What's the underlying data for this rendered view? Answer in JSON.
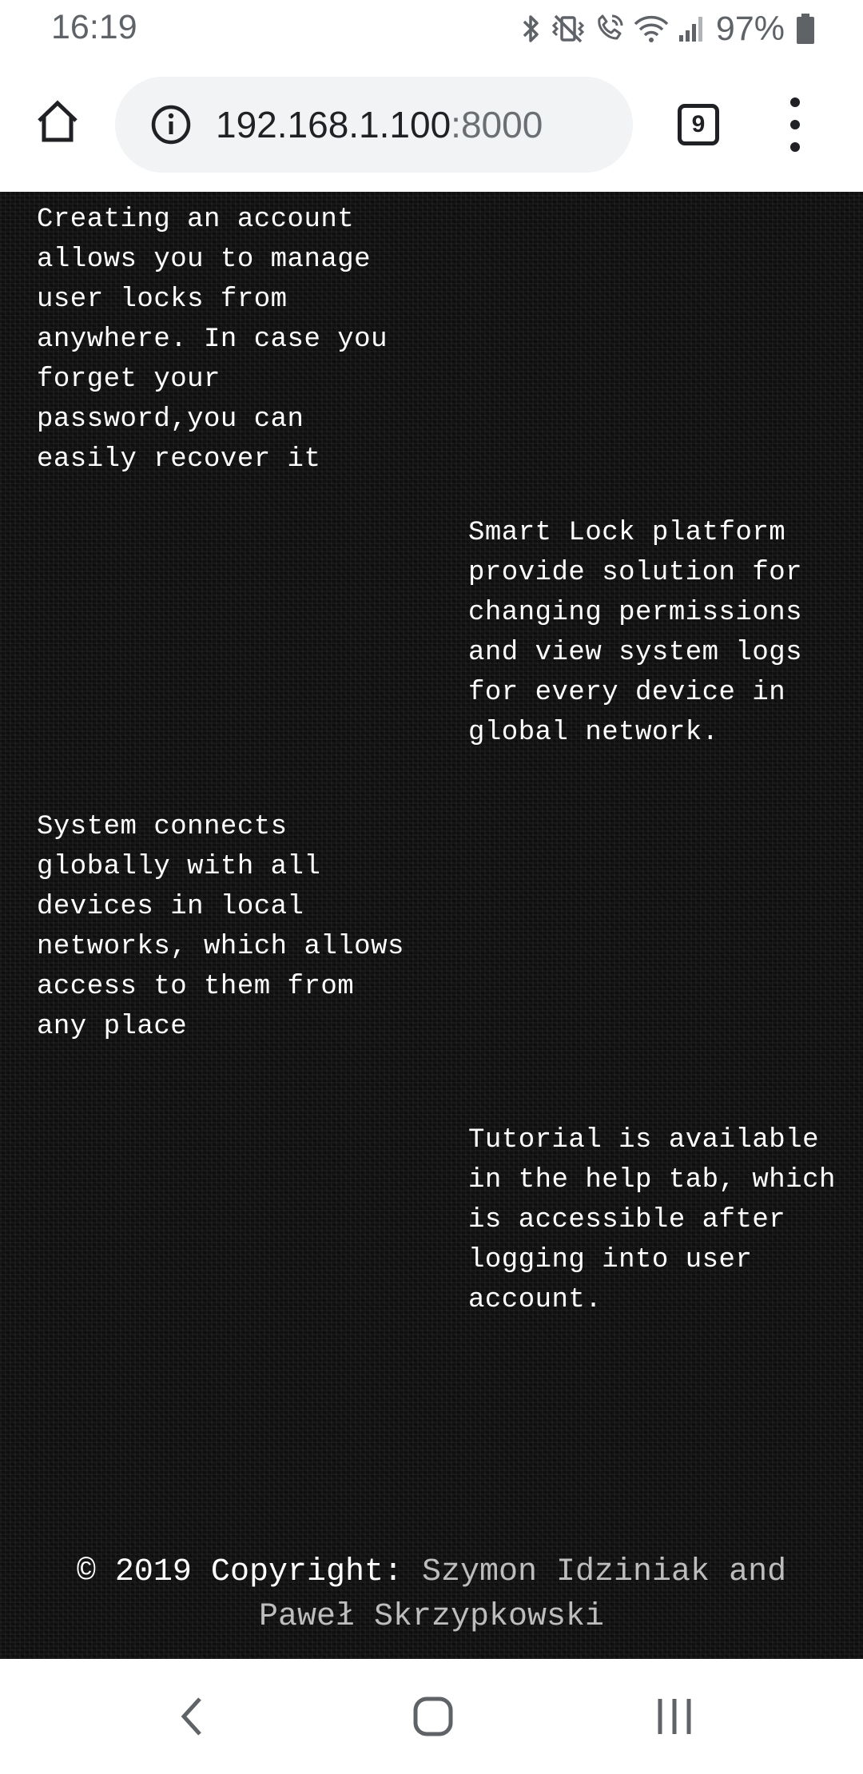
{
  "status_bar": {
    "time": "16:19",
    "battery_percent": "97%",
    "icons": [
      "bluetooth-icon",
      "vibrate-icon",
      "wifi-call-icon",
      "wifi-icon",
      "signal-icon",
      "battery-icon"
    ],
    "battery_level": 0.97
  },
  "browser": {
    "url_host": "192.168.1.100",
    "url_port": ":8000",
    "tab_count": "9",
    "icons": [
      "home-icon",
      "info-icon",
      "tabs-icon",
      "more-vert-icon"
    ]
  },
  "features": [
    {
      "text": "Creating an account allows you to manage user locks from anywhere. In case you forget your password,you can easily recover it"
    },
    {
      "text": "Smart Lock platform provide solution for changing permissions and view system logs for every device in global network."
    },
    {
      "text": "System connects globally with all devices in local networks, which allows access to them from any place"
    },
    {
      "text": "Tutorial is available in the help tab, which is accessible after logging into user account."
    }
  ],
  "footer": {
    "copyright_label": "© 2019 Copyright:",
    "authors_line1": "Szymon Idziniak and",
    "authors_line2": "Paweł Skrzypkowski"
  },
  "nav_bar": {
    "icons": [
      "back-icon",
      "home-circle-icon",
      "recent-apps-icon"
    ]
  },
  "colors": {
    "content_background": "#111111",
    "content_text": "#ffffff",
    "footer_author_text": "#bdbdbd",
    "url_bar_background": "#f1f3f4"
  }
}
